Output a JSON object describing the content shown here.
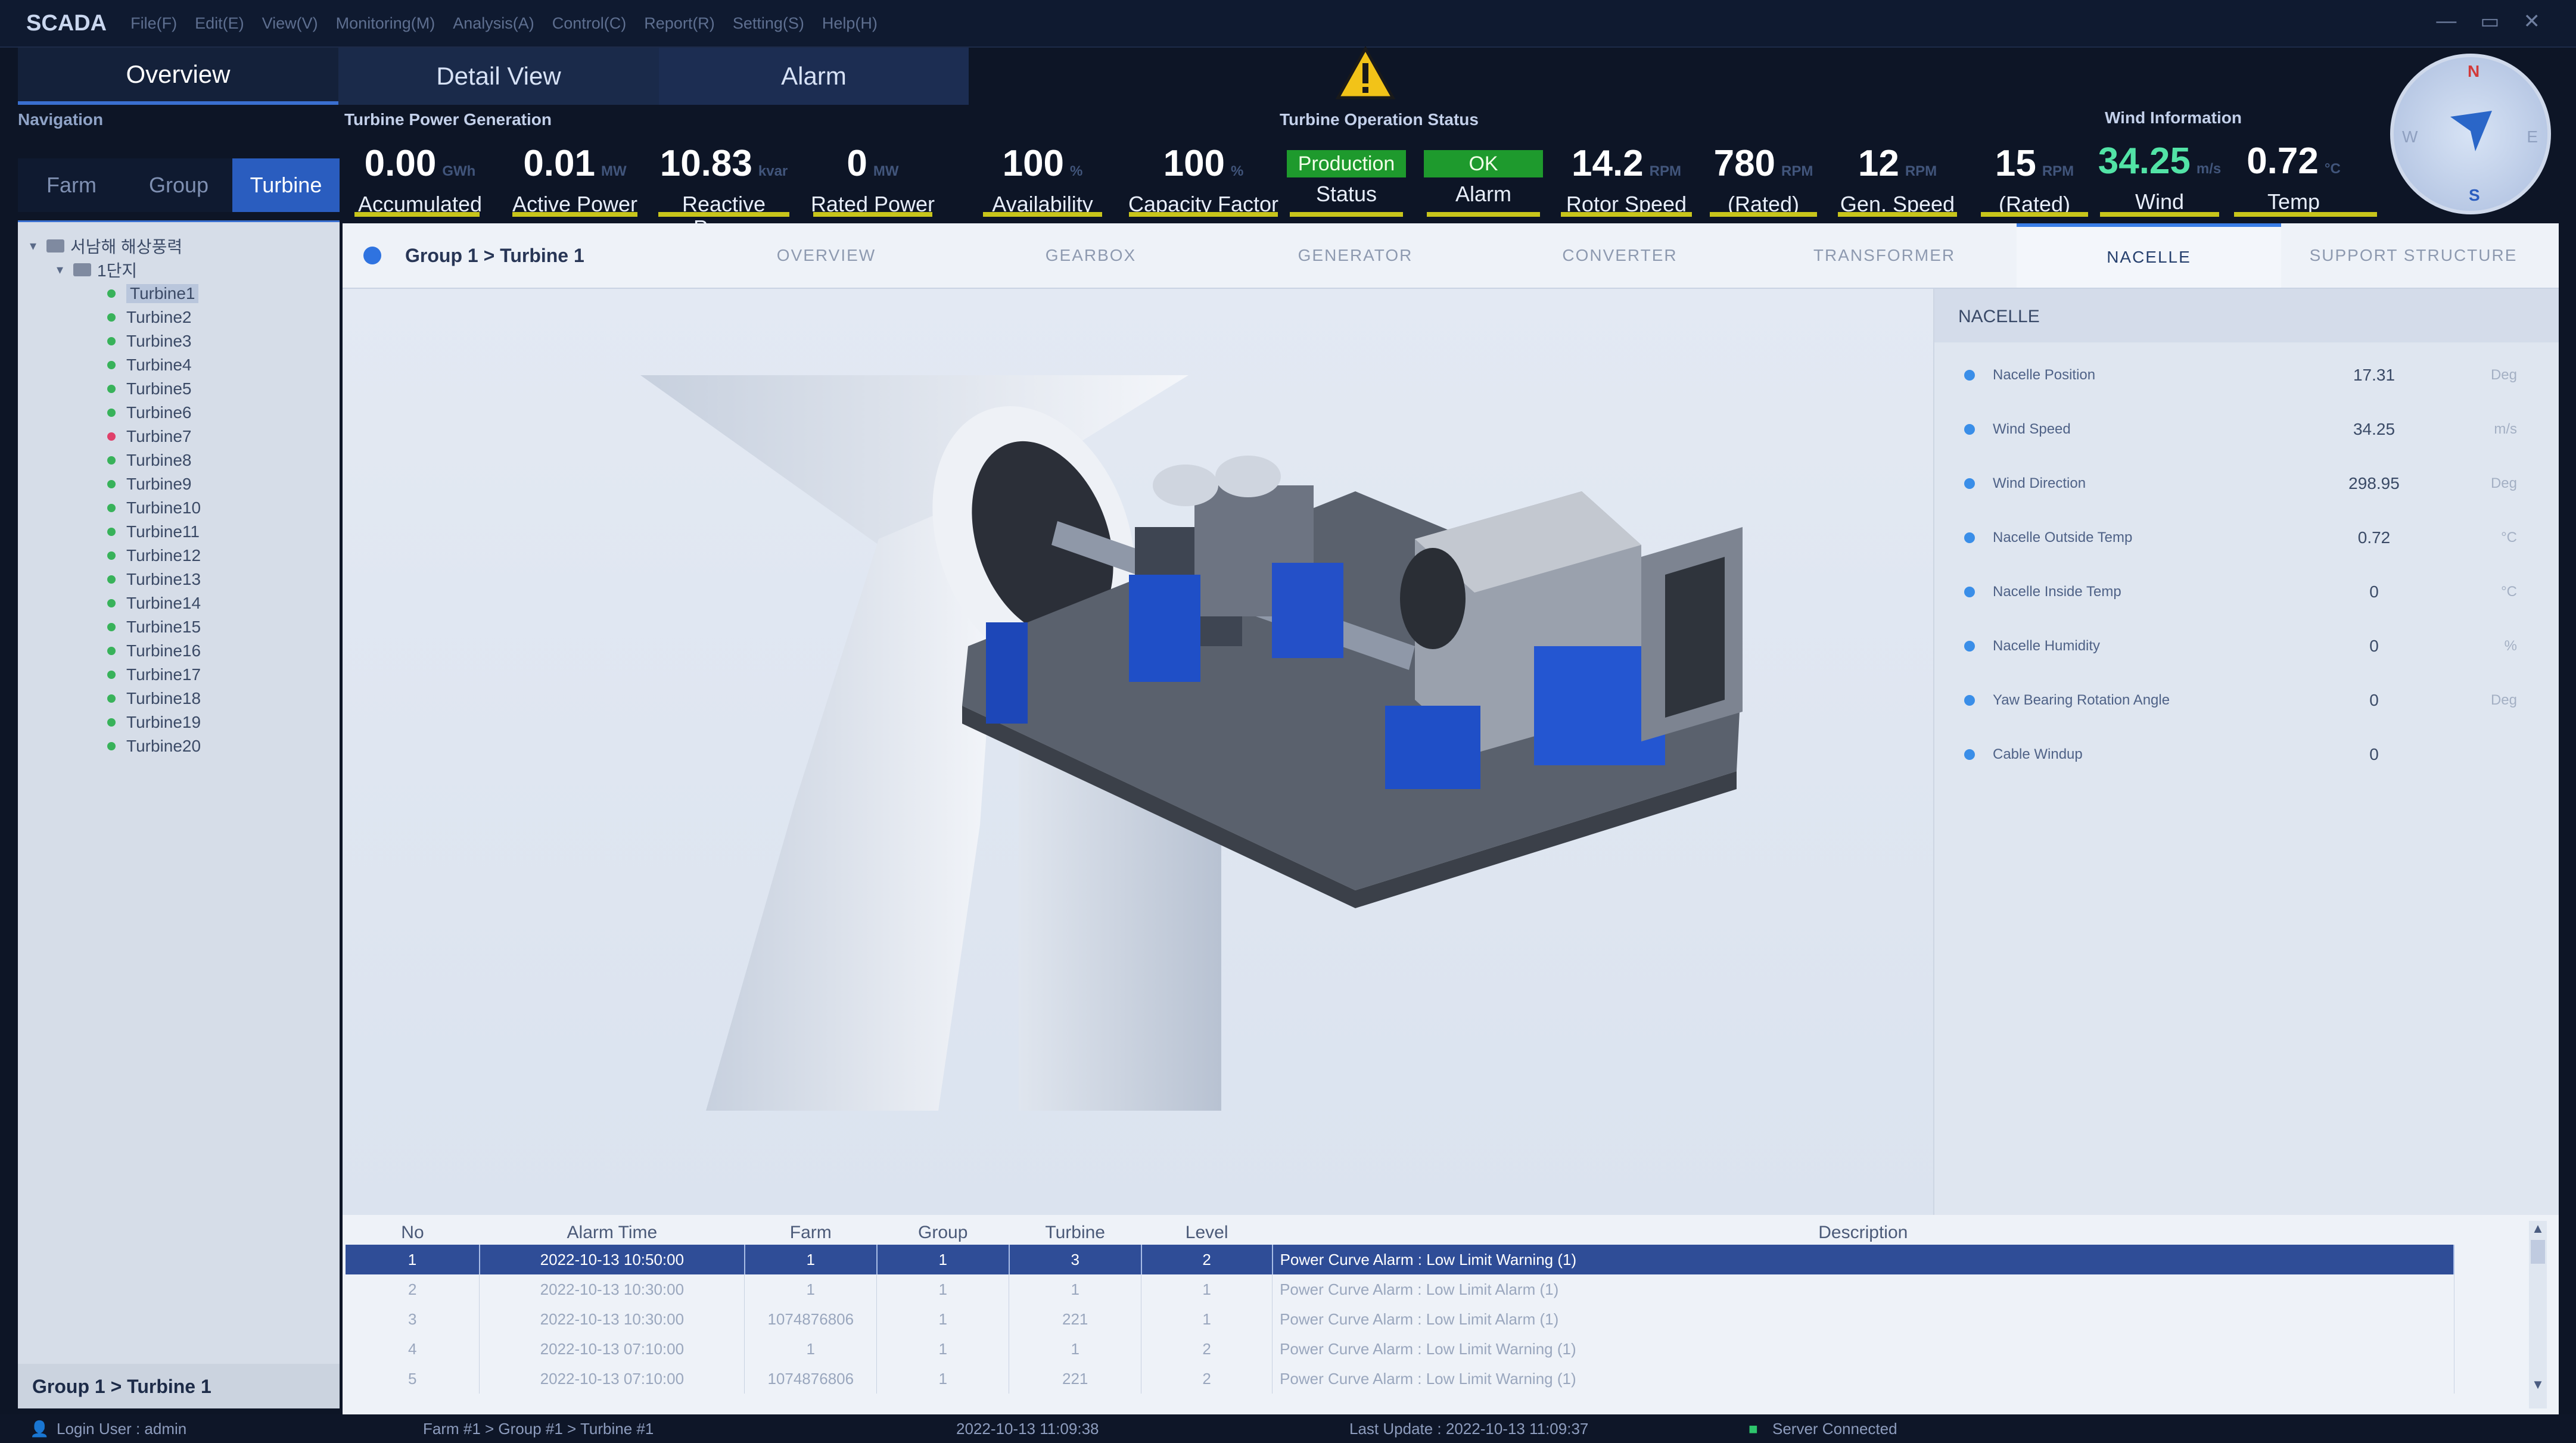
{
  "titlebar": {
    "app_title": "SCADA",
    "menu": [
      "File(F)",
      "Edit(E)",
      "View(V)",
      "Monitoring(M)",
      "Analysis(A)",
      "Control(C)",
      "Report(R)",
      "Setting(S)",
      "Help(H)"
    ],
    "window_controls": [
      "—",
      "▭",
      "✕"
    ]
  },
  "top_tabs": [
    {
      "label": "Overview",
      "active": true
    },
    {
      "label": "Detail View",
      "active": false
    },
    {
      "label": "Alarm",
      "active": false
    }
  ],
  "navigation": {
    "title": "Navigation",
    "tabs": [
      {
        "label": "Farm",
        "active": false
      },
      {
        "label": "Group",
        "active": false
      },
      {
        "label": "Turbine",
        "active": true
      }
    ],
    "tree_root": "서남해 해상풍력",
    "tree_group": "1단지",
    "turbines": [
      {
        "label": "Turbine1",
        "status": "ok"
      },
      {
        "label": "Turbine2",
        "status": "ok"
      },
      {
        "label": "Turbine3",
        "status": "ok"
      },
      {
        "label": "Turbine4",
        "status": "ok"
      },
      {
        "label": "Turbine5",
        "status": "ok"
      },
      {
        "label": "Turbine6",
        "status": "ok"
      },
      {
        "label": "Turbine7",
        "status": "alarm"
      },
      {
        "label": "Turbine8",
        "status": "ok"
      },
      {
        "label": "Turbine9",
        "status": "ok"
      },
      {
        "label": "Turbine10",
        "status": "ok"
      },
      {
        "label": "Turbine11",
        "status": "ok"
      },
      {
        "label": "Turbine12",
        "status": "ok"
      },
      {
        "label": "Turbine13",
        "status": "ok"
      },
      {
        "label": "Turbine14",
        "status": "ok"
      },
      {
        "label": "Turbine15",
        "status": "ok"
      },
      {
        "label": "Turbine16",
        "status": "ok"
      },
      {
        "label": "Turbine17",
        "status": "ok"
      },
      {
        "label": "Turbine18",
        "status": "ok"
      },
      {
        "label": "Turbine19",
        "status": "ok"
      },
      {
        "label": "Turbine20",
        "status": "ok"
      }
    ],
    "footer": "Group 1 > Turbine 1"
  },
  "power_generation": {
    "title": "Turbine Power Generation",
    "kpis": [
      {
        "value": "0.00",
        "unit": "GWh",
        "label": "Accumulated"
      },
      {
        "value": "0.01",
        "unit": "MW",
        "label": "Active Power"
      },
      {
        "value": "10.83",
        "unit": "kvar",
        "label": "Reactive Power"
      },
      {
        "value": "0",
        "unit": "MW",
        "label": "Rated Power"
      }
    ]
  },
  "operation_status": {
    "title": "Turbine Operation Status",
    "kpis": [
      {
        "value": "100",
        "unit": "%",
        "label": "Availability"
      },
      {
        "value": "100",
        "unit": "%",
        "label": "Capacity Factor"
      },
      {
        "value": "Production",
        "label": "Status"
      },
      {
        "value": "OK",
        "label": "Alarm"
      },
      {
        "value": "14.2",
        "unit": "RPM",
        "label": "Rotor Speed"
      },
      {
        "value": "780",
        "unit": "RPM",
        "label": "(Rated)"
      },
      {
        "value": "12",
        "unit": "RPM",
        "label": "Gen. Speed"
      },
      {
        "value": "15",
        "unit": "RPM",
        "label": "(Rated)"
      }
    ]
  },
  "wind_info": {
    "title": "Wind Information",
    "kpis": [
      {
        "value": "34.25",
        "unit": "m/s",
        "label": "Wind"
      },
      {
        "value": "0.72",
        "unit": "°C",
        "label": "Temp"
      }
    ],
    "compass": {
      "n": "N",
      "s": "S",
      "w": "W",
      "e": "E"
    }
  },
  "detail": {
    "breadcrumb": "Group 1 > Turbine 1",
    "subtabs": [
      {
        "label": "OVERVIEW",
        "active": false
      },
      {
        "label": "GEARBOX",
        "active": false
      },
      {
        "label": "GENERATOR",
        "active": false
      },
      {
        "label": "CONVERTER",
        "active": false
      },
      {
        "label": "TRANSFORMER",
        "active": false
      },
      {
        "label": "NACELLE",
        "active": true
      },
      {
        "label": "SUPPORT STRUCTURE",
        "active": false
      }
    ]
  },
  "nacelle_panel": {
    "title": "NACELLE",
    "rows": [
      {
        "name": "Nacelle Position",
        "value": "17.31",
        "unit": "Deg"
      },
      {
        "name": "Wind Speed",
        "value": "34.25",
        "unit": "m/s"
      },
      {
        "name": "Wind Direction",
        "value": "298.95",
        "unit": "Deg"
      },
      {
        "name": "Nacelle Outside Temp",
        "value": "0.72",
        "unit": "°C"
      },
      {
        "name": "Nacelle Inside Temp",
        "value": "0",
        "unit": "°C"
      },
      {
        "name": "Nacelle Humidity",
        "value": "0",
        "unit": "%"
      },
      {
        "name": "Yaw Bearing Rotation Angle",
        "value": "0",
        "unit": "Deg"
      },
      {
        "name": "Cable Windup",
        "value": "0",
        "unit": ""
      }
    ]
  },
  "alarm_table": {
    "columns": [
      "No",
      "Alarm Time",
      "Farm",
      "Group",
      "Turbine",
      "Level",
      "Description"
    ],
    "rows": [
      [
        "1",
        "2022-10-13 10:50:00",
        "1",
        "1",
        "3",
        "2",
        "Power Curve Alarm : Low Limit Warning  (1)"
      ],
      [
        "2",
        "2022-10-13 10:30:00",
        "1",
        "1",
        "1",
        "1",
        "Power Curve Alarm : Low Limit Alarm (1)"
      ],
      [
        "3",
        "2022-10-13 10:30:00",
        "1074876806",
        "1",
        "221",
        "1",
        "Power Curve Alarm : Low Limit Alarm (1)"
      ],
      [
        "4",
        "2022-10-13 07:10:00",
        "1",
        "1",
        "1",
        "2",
        "Power Curve Alarm : Low Limit Warning  (1)"
      ],
      [
        "5",
        "2022-10-13 07:10:00",
        "1074876806",
        "1",
        "221",
        "2",
        "Power Curve Alarm : Low Limit Warning  (1)"
      ]
    ]
  },
  "statusbar": {
    "login": "Login User : admin",
    "path": "Farm #1 > Group #1 > Turbine #1",
    "clock": "2022-10-13 11:09:38",
    "last_update": "Last Update : 2022-10-13 11:09:37",
    "server": "Server Connected"
  },
  "colors": {
    "accent": "#2a5dbf",
    "production_green": "#1e9a2d",
    "kpi_underline": "#c8c51b",
    "wind_value": "#52e3a6",
    "alarm_red": "#e0406a"
  }
}
